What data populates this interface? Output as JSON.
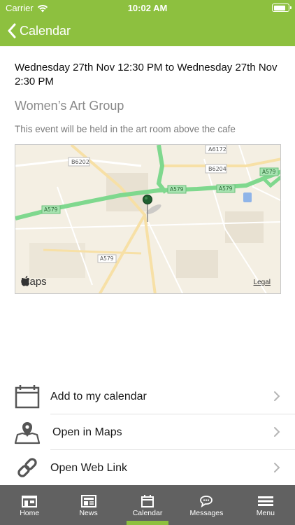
{
  "status_bar": {
    "carrier": "Carrier",
    "time": "10:02 AM",
    "battery_level": 0.85
  },
  "header": {
    "back_label": "Calendar"
  },
  "event": {
    "date_range": "Wednesday 27th Nov 12:30 PM to Wednesday 27th Nov 2:30 PM",
    "title": "Women’s Art Group",
    "description": "This event will be held in the art room above the cafe"
  },
  "map": {
    "provider_label": "Maps",
    "legal_label": "Legal",
    "road_labels": [
      "A6172",
      "B6202",
      "B6204",
      "A579",
      "A579",
      "A579",
      "A579",
      "A579"
    ],
    "colors": {
      "land": "#f4efe3",
      "major_road": "#7fd88e",
      "minor_road": "#f7e0a6",
      "street": "#ffffff",
      "block": "#e8e1d2",
      "pin": "#1f5f2f"
    }
  },
  "actions": [
    {
      "label": "Add to my calendar",
      "icon": "calendar-icon"
    },
    {
      "label": "Open in Maps",
      "icon": "map-pin-icon"
    },
    {
      "label": "Open Web Link",
      "icon": "link-icon"
    }
  ],
  "tabs": [
    {
      "label": "Home",
      "icon": "home-icon",
      "active": false
    },
    {
      "label": "News",
      "icon": "newspaper-icon",
      "active": false
    },
    {
      "label": "Calendar",
      "icon": "calendar-icon",
      "active": true
    },
    {
      "label": "Messages",
      "icon": "chat-icon",
      "active": false
    },
    {
      "label": "Menu",
      "icon": "hamburger-icon",
      "active": false
    }
  ],
  "colors": {
    "accent": "#8dc03f",
    "tab_bar": "#616161"
  }
}
